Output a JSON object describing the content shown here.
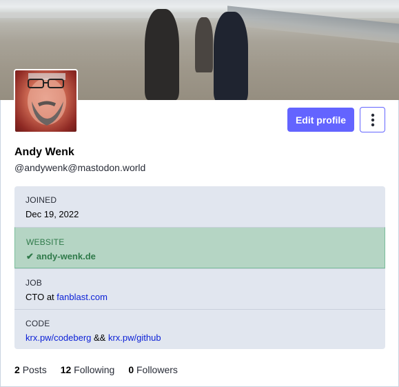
{
  "profile": {
    "display_name": "Andy Wenk",
    "handle": "@andywenk@mastodon.world",
    "edit_label": "Edit profile",
    "more_icon": "kebab-menu-icon"
  },
  "fields": [
    {
      "label": "JOINED",
      "value": "Dec 19, 2022"
    },
    {
      "label": "WEBSITE",
      "value": "andy-wenk.de",
      "verified": true
    },
    {
      "label": "JOB",
      "prefix": "CTO at ",
      "link": "fanblast.com"
    },
    {
      "label": "CODE",
      "link1": "krx.pw/codeberg",
      "sep": " && ",
      "link2": "krx.pw/github"
    }
  ],
  "stats": {
    "posts_count": "2",
    "posts_label": "Posts",
    "following_count": "12",
    "following_label": "Following",
    "followers_count": "0",
    "followers_label": "Followers"
  },
  "colors": {
    "accent": "#6364ff",
    "verified_bg": "#b5d5c4",
    "verified_text": "#2f7a4a",
    "fields_bg": "#e1e6ef",
    "link": "#0a1fd6"
  }
}
